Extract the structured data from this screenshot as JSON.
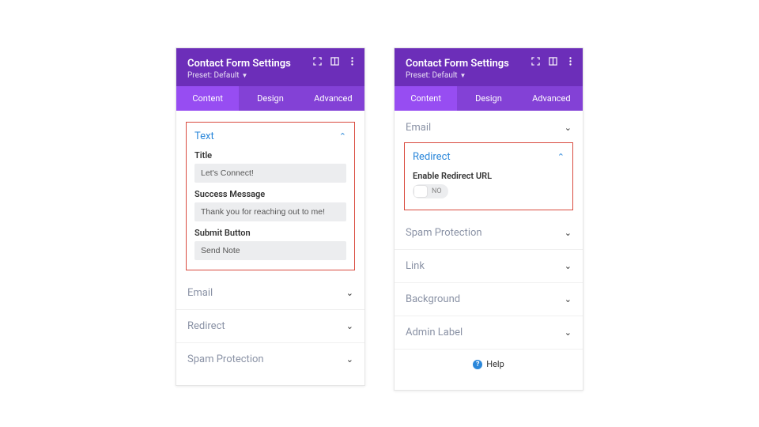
{
  "header": {
    "title": "Contact Form Settings",
    "preset_label": "Preset: Default"
  },
  "tabs": {
    "content": "Content",
    "design": "Design",
    "advanced": "Advanced"
  },
  "left": {
    "text_section": "Text",
    "title_label": "Title",
    "title_value": "Let's Connect!",
    "success_label": "Success Message",
    "success_value": "Thank you for reaching out to me!",
    "submit_label": "Submit Button",
    "submit_value": "Send Note",
    "rows": {
      "email": "Email",
      "redirect": "Redirect",
      "spam": "Spam Protection"
    }
  },
  "right": {
    "rows": {
      "email": "Email",
      "spam": "Spam Protection",
      "link": "Link",
      "background": "Background",
      "admin": "Admin Label"
    },
    "redirect_section": "Redirect",
    "enable_label": "Enable Redirect URL",
    "toggle_value": "NO",
    "help": "Help"
  }
}
